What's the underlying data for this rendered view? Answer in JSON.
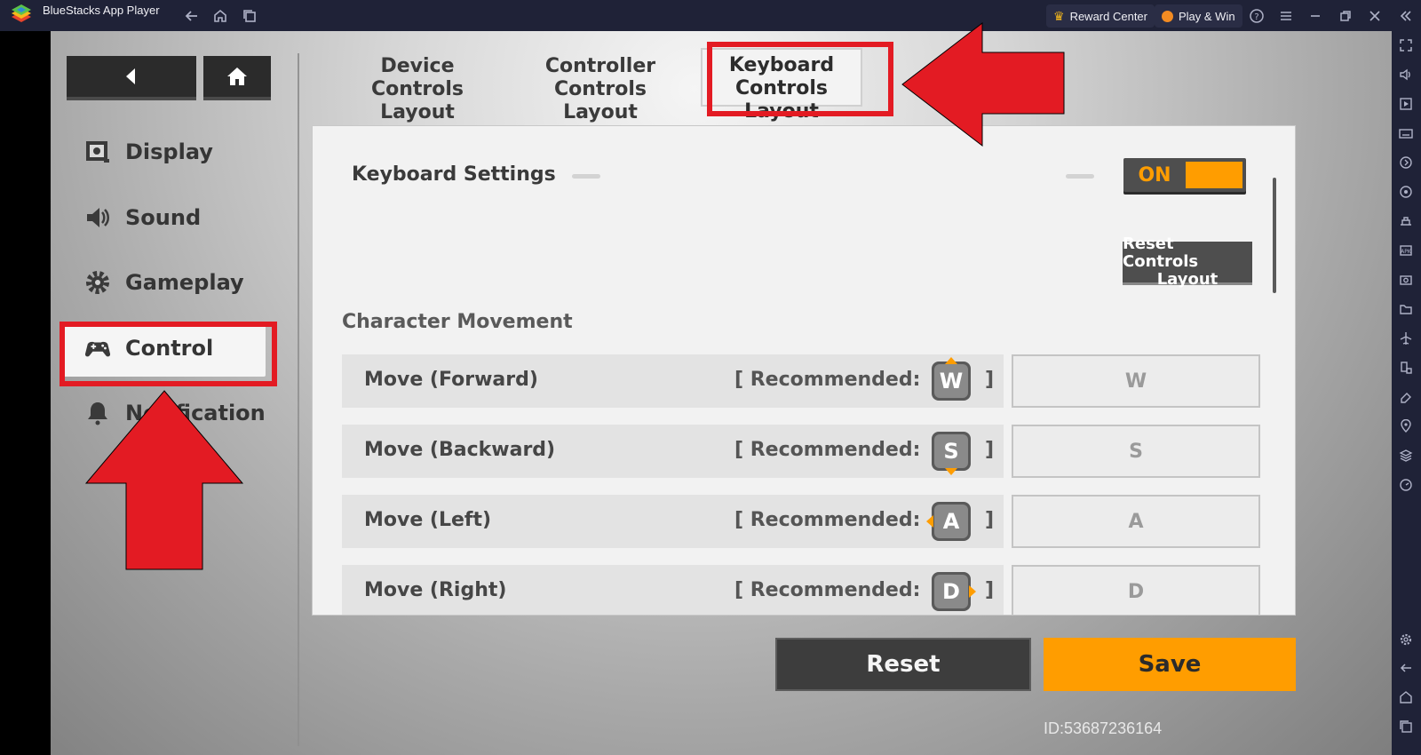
{
  "titlebar": {
    "app_title": "BlueStacks App Player",
    "reward_center": "Reward Center",
    "play_win": "Play & Win"
  },
  "nav": {
    "back_label": "",
    "home_label": ""
  },
  "menu": {
    "items": [
      {
        "label": "Display",
        "icon": "display-icon"
      },
      {
        "label": "Sound",
        "icon": "speaker-icon"
      },
      {
        "label": "Gameplay",
        "icon": "gear-icon"
      },
      {
        "label": "Control",
        "icon": "gamepad-icon"
      },
      {
        "label": "Notification",
        "icon": "bell-icon"
      }
    ],
    "selected": "Control"
  },
  "tabs": [
    {
      "line1": "Device Controls",
      "line2": "Layout"
    },
    {
      "line1": "Controller",
      "line2": "Controls Layout"
    },
    {
      "line1": "Keyboard",
      "line2": "Controls Layout"
    }
  ],
  "panel": {
    "keyboard_settings_label": "Keyboard Settings",
    "toggle_label": "ON",
    "reset_layout_label_1": "Reset Controls",
    "reset_layout_label_2": "Layout",
    "section_title": "Character Movement",
    "recommended_prefix": "[ Recommended:",
    "bracket_close": "]",
    "rows": [
      {
        "label": "Move (Forward)",
        "recommended_key": "W",
        "assigned_key": "W"
      },
      {
        "label": "Move (Backward)",
        "recommended_key": "S",
        "assigned_key": "S"
      },
      {
        "label": "Move (Left)",
        "recommended_key": "A",
        "assigned_key": "A"
      },
      {
        "label": "Move (Right)",
        "recommended_key": "D",
        "assigned_key": "D"
      }
    ]
  },
  "buttons": {
    "reset": "Reset",
    "save": "Save"
  },
  "footer_id": "ID:53687236164",
  "colors": {
    "accent_orange": "#ff9d00",
    "highlight_red": "#e31b23",
    "titlebar_bg": "#1f2237"
  }
}
